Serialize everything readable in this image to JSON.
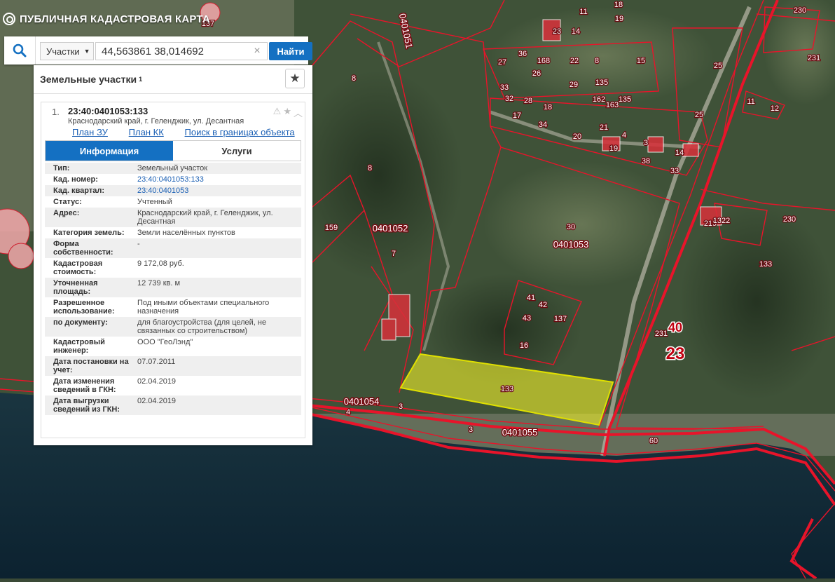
{
  "app": {
    "title": "ПУБЛИЧНАЯ КАДАСТРОВАЯ КАРТА"
  },
  "search": {
    "type_label": "Участки",
    "query": "44,563861 38,014692",
    "button_label": "Найти",
    "clear_symbol": "×"
  },
  "panel": {
    "title": "Земельные участки",
    "count": "1",
    "item": {
      "number": "1.",
      "cadastral_number": "23:40:0401053:133",
      "address": "Краснодарский край, г. Геленджик, ул. Десантная",
      "links": [
        "План ЗУ →",
        "План КК →",
        "Поиск в границах объекта →"
      ],
      "tabs": [
        "Информация",
        "Услуги"
      ],
      "fields": [
        {
          "key": "Тип:",
          "value": "Земельный участок"
        },
        {
          "key": "Кад. номер:",
          "value": "23:40:0401053:133",
          "link": true
        },
        {
          "key": "Кад. квартал:",
          "value": "23:40:0401053",
          "link": true
        },
        {
          "key": "Статус:",
          "value": "Учтенный"
        },
        {
          "key": "Адрес:",
          "value": "Краснодарский край, г. Геленджик, ул. Десантная"
        },
        {
          "key": "Категория земель:",
          "value": "Земли населённых пунктов"
        },
        {
          "key": "Форма собственности:",
          "value": "-"
        },
        {
          "key": "Кадастровая стоимость:",
          "value": "9 172,08 руб."
        },
        {
          "key": "Уточненная площадь:",
          "value": "12 739 кв. м"
        },
        {
          "key": "Разрешенное использование:",
          "value": "Под иными объектами специального назначения"
        },
        {
          "key": "по документу:",
          "value": "для благоустройства (для целей, не связанных со строительством)"
        },
        {
          "key": "Кадастровый инженер:",
          "value": "ООО \"ГеоЛэнд\""
        },
        {
          "key": "Дата постановки на учет:",
          "value": "07.07.2011"
        },
        {
          "key": "Дата изменения сведений в ГКН:",
          "value": "02.04.2019"
        },
        {
          "key": "Дата выгрузки сведений из ГКН:",
          "value": "02.04.2019"
        }
      ]
    }
  },
  "map": {
    "quarters": [
      "0401051",
      "0401052",
      "0401053",
      "0401054",
      "0401055"
    ],
    "parcels": [
      "137",
      "8",
      "8",
      "7",
      "159",
      "30",
      "133",
      "16",
      "41",
      "42",
      "43",
      "137",
      "3",
      "3",
      "4",
      "60",
      "231",
      "25",
      "25",
      "133",
      "230",
      "230",
      "231",
      "11",
      "12",
      "219",
      "1322",
      "36",
      "168",
      "22",
      "8",
      "27",
      "26",
      "29",
      "33",
      "32",
      "28",
      "18",
      "17",
      "34",
      "20",
      "21",
      "4",
      "19",
      "3",
      "38",
      "14",
      "33",
      "135",
      "162",
      "163",
      "135",
      "23",
      "14",
      "11",
      "18",
      "19",
      "15"
    ],
    "district": "40",
    "region": "23",
    "colors": {
      "boundary": "#e8142a",
      "selected_fill": "#ecec2a",
      "sea": "#0e2633",
      "land": "#3f5238"
    }
  }
}
